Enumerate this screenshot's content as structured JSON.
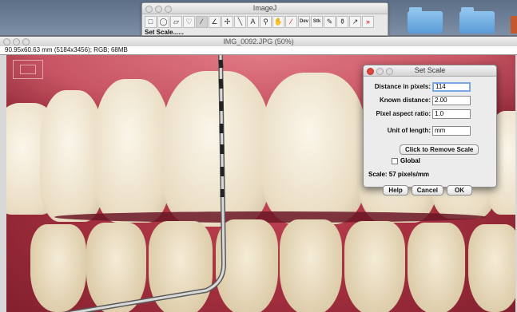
{
  "toolbar_window": {
    "title": "ImageJ",
    "status": "Set Scale......",
    "tools": [
      {
        "name": "rectangle-tool-icon",
        "glyph": "□"
      },
      {
        "name": "oval-tool-icon",
        "glyph": "◯"
      },
      {
        "name": "polygon-tool-icon",
        "glyph": "▱"
      },
      {
        "name": "freehand-tool-icon",
        "glyph": "♡"
      },
      {
        "name": "line-tool-icon",
        "glyph": "⁄"
      },
      {
        "name": "angle-tool-icon",
        "glyph": "∠"
      },
      {
        "name": "point-tool-icon",
        "glyph": "✢"
      },
      {
        "name": "wand-tool-icon",
        "glyph": "╲"
      },
      {
        "name": "text-tool-icon",
        "glyph": "A"
      },
      {
        "name": "magnifier-tool-icon",
        "glyph": "⚲"
      },
      {
        "name": "hand-tool-icon",
        "glyph": "✋"
      },
      {
        "name": "dropper-tool-icon",
        "glyph": "⁄"
      },
      {
        "name": "dev-tool-icon",
        "glyph": "Dev"
      },
      {
        "name": "stk-tool-icon",
        "glyph": "Stk"
      },
      {
        "name": "pencil-tool-icon",
        "glyph": "✎"
      },
      {
        "name": "brush-tool-icon",
        "glyph": "⚱"
      },
      {
        "name": "arrow-tool-icon",
        "glyph": "↗"
      },
      {
        "name": "more-tools-icon",
        "glyph": "»"
      }
    ]
  },
  "image_window": {
    "title": "IMG_0092.JPG (50%)",
    "info": "90.95x60.63 mm (5184x3456); RGB; 68MB"
  },
  "set_scale_dialog": {
    "title": "Set Scale",
    "distance_label": "Distance in pixels:",
    "distance_value": "114",
    "known_label": "Known distance:",
    "known_value": "2.00",
    "aspect_label": "Pixel aspect ratio:",
    "aspect_value": "1.0",
    "unit_label": "Unit of length:",
    "unit_value": "mm",
    "remove_button": "Click to Remove Scale",
    "global_label": "Global",
    "scale_text": "Scale: 57 pixels/mm",
    "help_button": "Help",
    "cancel_button": "Cancel",
    "ok_button": "OK"
  },
  "colors": {
    "gum": "#b23a4b",
    "tooth": "#f3ead6",
    "dialog_focus": "#7aa7e6",
    "close_button": "#e0443e"
  }
}
